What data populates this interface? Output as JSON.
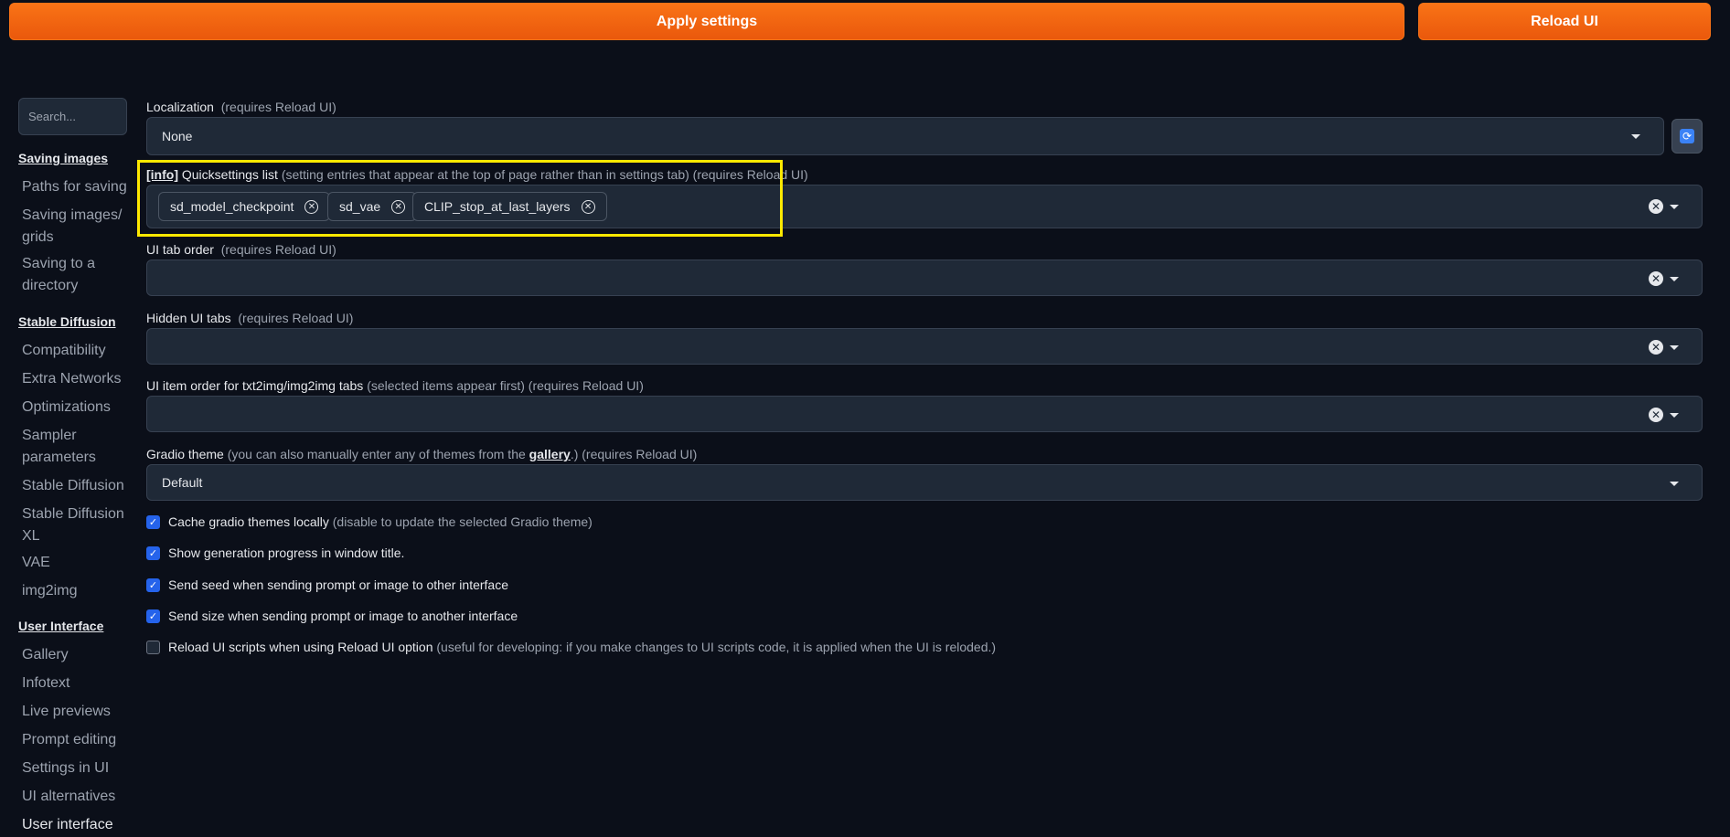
{
  "topbar": {
    "apply_label": "Apply settings",
    "reload_label": "Reload UI"
  },
  "sidebar": {
    "search_placeholder": "Search...",
    "sections": [
      {
        "title": "Saving images",
        "items": [
          "Paths for saving",
          "Saving images/ grids",
          "Saving to a directory"
        ]
      },
      {
        "title": "Stable Diffusion",
        "items": [
          "Compatibility",
          "Extra Networks",
          "Optimizations",
          "Sampler parameters",
          "Stable Diffusion",
          "Stable Diffusion XL",
          "VAE",
          "img2img"
        ]
      },
      {
        "title": "User Interface",
        "items": [
          "Gallery",
          "Infotext",
          "Live previews",
          "Prompt editing",
          "Settings in UI",
          "UI alternatives",
          "User interface"
        ]
      }
    ],
    "active_item": "User interface"
  },
  "settings": {
    "localization": {
      "label": "Localization",
      "note": "(requires Reload UI)",
      "value": "None"
    },
    "quicksettings": {
      "info": "[info]",
      "label": "Quicksettings list",
      "note": "(setting entries that appear at the top of page rather than in settings tab) (requires Reload UI)",
      "chips": [
        "sd_model_checkpoint",
        "sd_vae",
        "CLIP_stop_at_last_layers"
      ]
    },
    "ui_tab_order": {
      "label": "UI tab order",
      "note": "(requires Reload UI)"
    },
    "hidden_ui_tabs": {
      "label": "Hidden UI tabs",
      "note": "(requires Reload UI)"
    },
    "ui_item_order": {
      "label": "UI item order for txt2img/img2img tabs",
      "note": "(selected items appear first) (requires Reload UI)"
    },
    "gradio_theme": {
      "label": "Gradio theme",
      "note_pre": "(you can also manually enter any of themes from the",
      "link": "gallery",
      "note_post": ".) (requires Reload UI)",
      "value": "Default"
    },
    "checkboxes": [
      {
        "label": "Cache gradio themes locally",
        "note": "(disable to update the selected Gradio theme)",
        "checked": true
      },
      {
        "label": "Show generation progress in window title.",
        "note": "",
        "checked": true
      },
      {
        "label": "Send seed when sending prompt or image to other interface",
        "note": "",
        "checked": true
      },
      {
        "label": "Send size when sending prompt or image to another interface",
        "note": "",
        "checked": true
      },
      {
        "label": "Reload UI scripts when using Reload UI option",
        "note": "(useful for developing: if you make changes to UI scripts code, it is applied when the UI is reloded.)",
        "checked": false
      }
    ]
  },
  "colors": {
    "accent": "#f97316",
    "background": "#0b0f19",
    "highlight": "#fde800",
    "checkbox": "#2563eb"
  }
}
